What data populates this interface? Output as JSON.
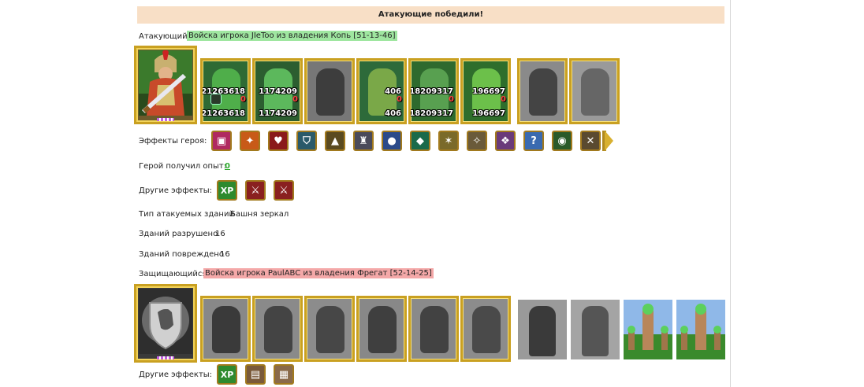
{
  "result": {
    "title": "Атакующие победили!"
  },
  "attacker": {
    "label": "Атакующий",
    "army": "Войска игрока JIeToo из владения Копь [51-13-46]",
    "units": [
      {
        "count": "21263618",
        "lost": "0",
        "remaining": "21263618"
      },
      {
        "count": "1174209",
        "lost": "0",
        "remaining": "1174209"
      },
      {
        "count": "",
        "lost": "",
        "remaining": ""
      },
      {
        "count": "406",
        "lost": "0",
        "remaining": "406"
      },
      {
        "count": "18209317",
        "lost": "0",
        "remaining": "18209317"
      },
      {
        "count": "196697",
        "lost": "0",
        "remaining": "196697"
      },
      {
        "count": "",
        "lost": "",
        "remaining": ""
      },
      {
        "count": "",
        "lost": "",
        "remaining": ""
      }
    ],
    "hero_effects_label": "Эффекты героя:",
    "hero_effects": [
      "chest-icon",
      "fire-scroll-icon",
      "heart-icon",
      "shield-icon",
      "helmet-icon",
      "armor-icon",
      "boots-icon",
      "amulet-icon",
      "star-rune-icon",
      "gauntlet-icon",
      "wings-icon",
      "question-icon",
      "eye-icon",
      "sword-arm-icon"
    ],
    "hero_effects_more": "arrow-right-icon",
    "experience_label": "Герой получил опыт:",
    "experience_value": "0",
    "other_effects_label": "Другие эффекты:",
    "other_effects": [
      {
        "icon": "xp-icon",
        "text": "XP"
      },
      {
        "icon": "sword-heart-icon",
        "text": ""
      },
      {
        "icon": "sword-heart-icon-2",
        "text": ""
      }
    ],
    "target_buildings_label": "Тип атакуемых зданий",
    "target_buildings_value": "Башня зеркал",
    "destroyed_label": "Зданий разрушено",
    "destroyed_value": "16",
    "damaged_label": "Зданий повреждено",
    "damaged_value": "16"
  },
  "defender": {
    "label": "Защищающийся",
    "army": "Войска игрока PaulABC из владения Фрегат [52-14-25]",
    "other_effects_label": "Другие эффекты:",
    "other_effects": [
      {
        "icon": "xp-icon",
        "text": "XP"
      },
      {
        "icon": "book-icon",
        "text": ""
      },
      {
        "icon": "wall-icon",
        "text": ""
      }
    ]
  },
  "colors": {
    "banner_bg": "#f8dfc6",
    "attacker_tag": "#9fe6a0",
    "defender_tag": "#f4a8a8",
    "frame_gold": "#c9a021",
    "exp_green": "#2eaa2e"
  }
}
